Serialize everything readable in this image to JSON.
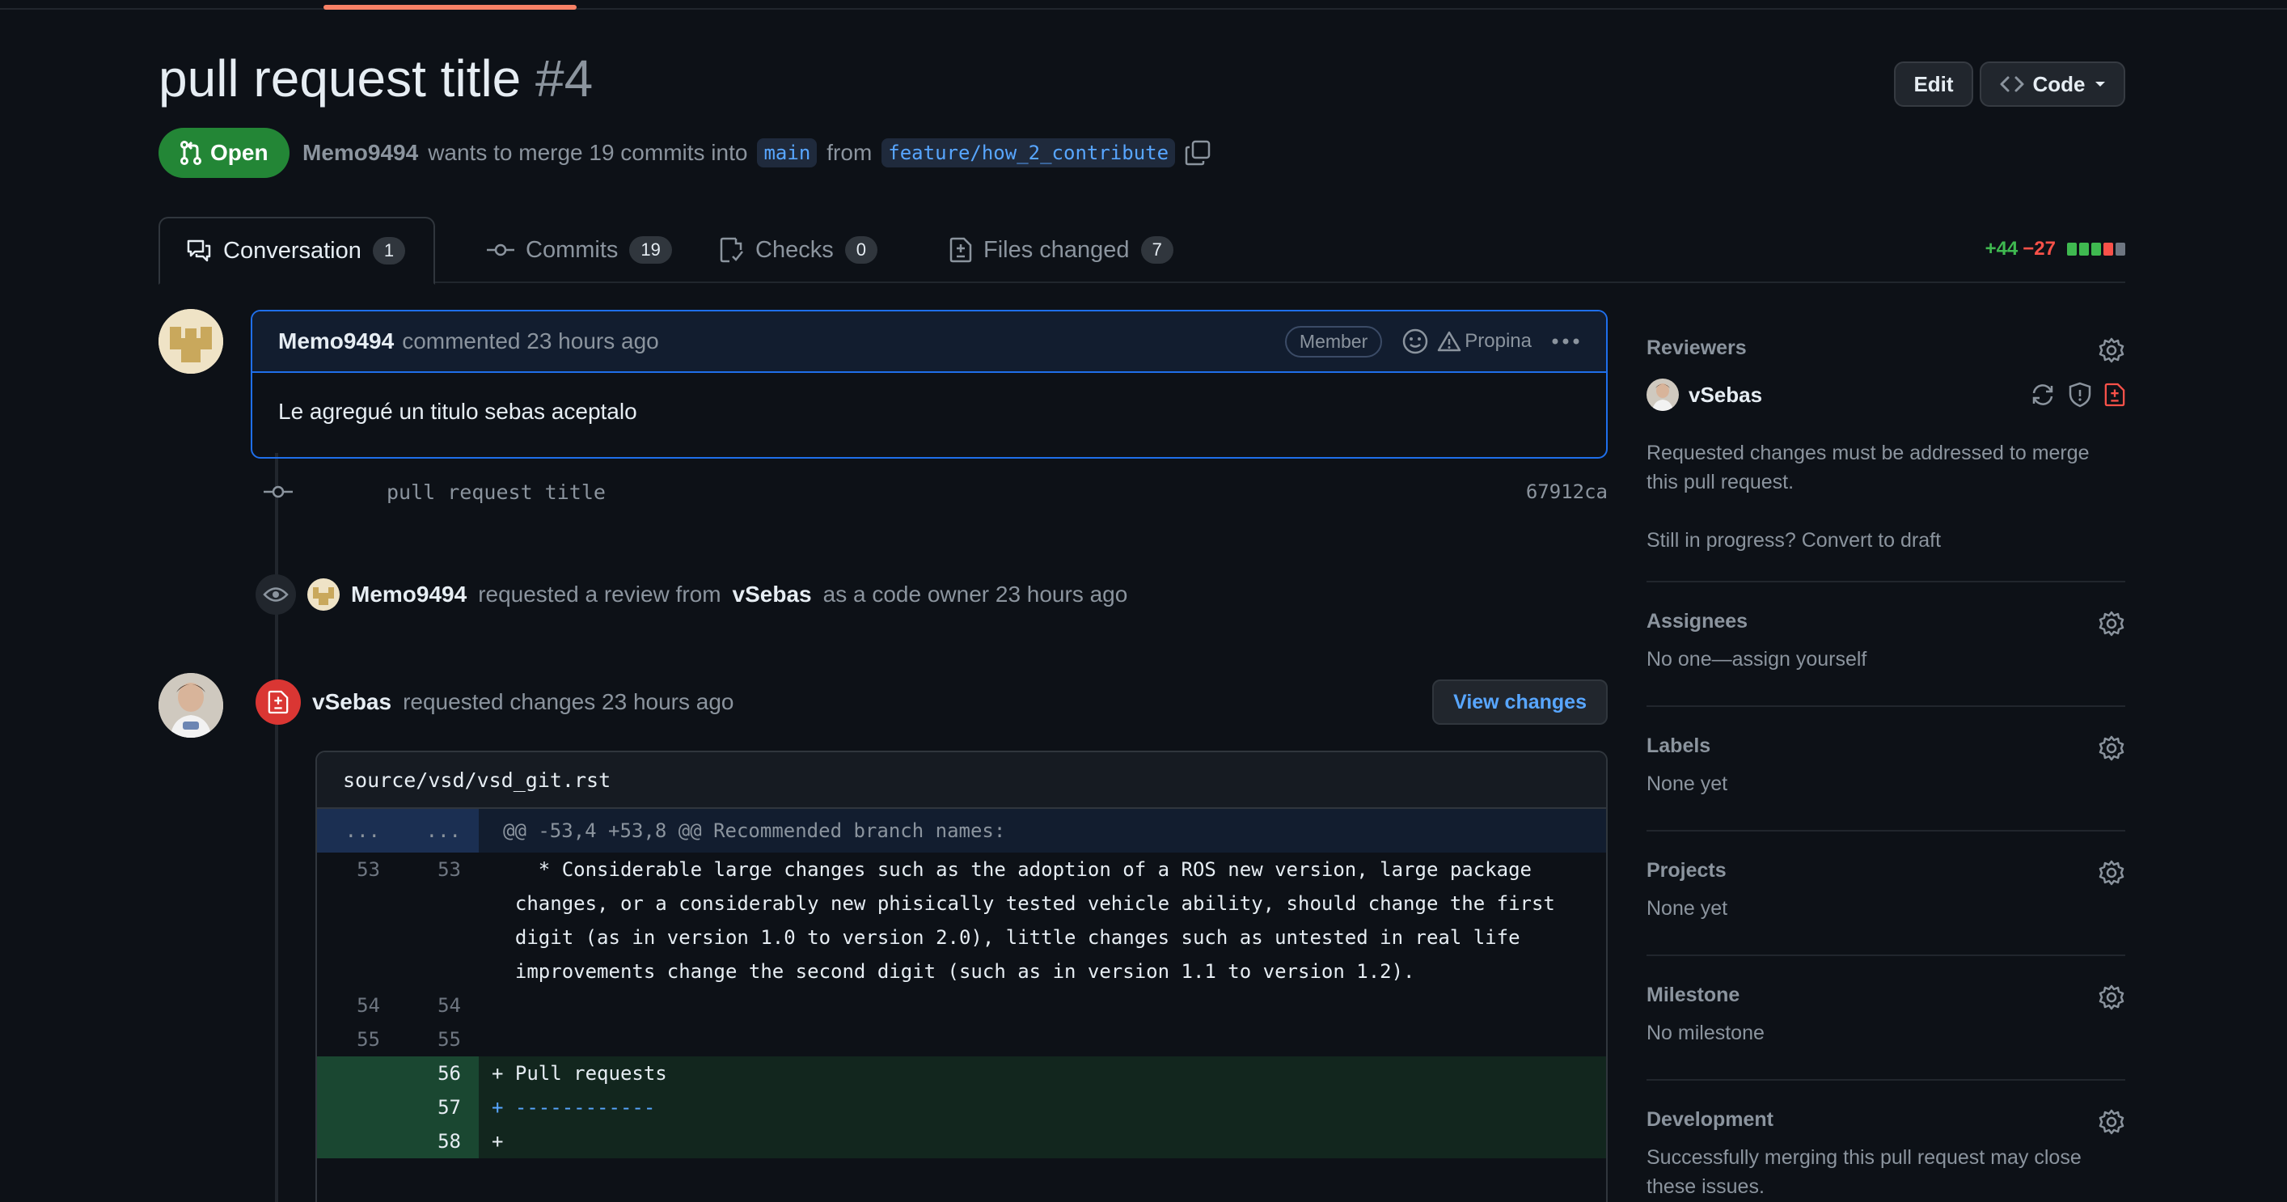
{
  "pr": {
    "title": "pull request title",
    "number": "#4",
    "state": "Open",
    "author": "Memo9494",
    "merge_text": "wants to merge 19 commits into",
    "base_branch": "main",
    "from_text": "from",
    "head_branch": "feature/how_2_contribute"
  },
  "header": {
    "edit_label": "Edit",
    "code_label": "Code"
  },
  "tabs": [
    {
      "label": "Conversation",
      "count": "1"
    },
    {
      "label": "Commits",
      "count": "19"
    },
    {
      "label": "Checks",
      "count": "0"
    },
    {
      "label": "Files changed",
      "count": "7"
    }
  ],
  "diffstat": {
    "additions": "+44",
    "deletions": "−27",
    "bar_colors": [
      "#3fb950",
      "#3fb950",
      "#3fb950",
      "#f85149",
      "#6e7681"
    ]
  },
  "comment": {
    "author": "Memo9494",
    "action": "commented 23 hours ago",
    "badge": "Member",
    "propina": "Propina",
    "body": "Le agregué un titulo sebas aceptalo"
  },
  "commit": {
    "message": "pull request title",
    "sha": "67912ca"
  },
  "review_request": {
    "actor": "Memo9494",
    "text1": "requested a review from",
    "reviewer": "vSebas",
    "text2": "as a code owner 23 hours ago"
  },
  "review": {
    "author": "vSebas",
    "action": "requested changes 23 hours ago",
    "view_changes": "View changes"
  },
  "diff": {
    "file": "source/vsd/vsd_git.rst",
    "hunk_left": "...",
    "hunk_right": "...",
    "hunk_header": "@@ -53,4 +53,8 @@ Recommended branch names:",
    "lines": [
      {
        "old": "53",
        "new": "53",
        "text": "    * Considerable large changes such as the adoption of a ROS new version, large package",
        "type": "ctx"
      },
      {
        "old": "",
        "new": "",
        "text": "  changes, or a considerably new phisically tested vehicle ability, should change the first",
        "type": "ctx"
      },
      {
        "old": "",
        "new": "",
        "text": "  digit (as in version 1.0 to version 2.0), little changes such as untested in real life",
        "type": "ctx"
      },
      {
        "old": "",
        "new": "",
        "text": "  improvements change the second digit (such as in version 1.1 to version 1.2).",
        "type": "ctx"
      },
      {
        "old": "54",
        "new": "54",
        "text": "",
        "type": "ctx"
      },
      {
        "old": "55",
        "new": "55",
        "text": "",
        "type": "ctx"
      },
      {
        "old": "",
        "new": "56",
        "text": "+ Pull requests",
        "type": "add"
      },
      {
        "old": "",
        "new": "57",
        "text": "+ ------------",
        "type": "add"
      },
      {
        "old": "",
        "new": "58",
        "text": "+",
        "type": "add"
      }
    ]
  },
  "sidebar": {
    "reviewers": {
      "title": "Reviewers",
      "name": "vSebas",
      "note": "Requested changes must be addressed to merge this pull request.",
      "draft_link": "Still in progress? Convert to draft"
    },
    "assignees": {
      "title": "Assignees",
      "value": "No one—assign yourself"
    },
    "labels": {
      "title": "Labels",
      "value": "None yet"
    },
    "projects": {
      "title": "Projects",
      "value": "None yet"
    },
    "milestone": {
      "title": "Milestone",
      "value": "No milestone"
    },
    "development": {
      "title": "Development",
      "value": "Successfully merging this pull request may close these issues."
    }
  }
}
